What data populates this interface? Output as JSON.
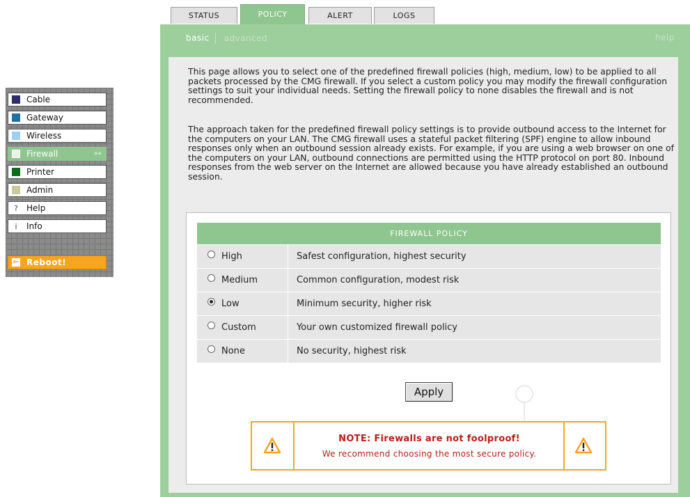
{
  "tabs": [
    {
      "label": "STATUS"
    },
    {
      "label": "POLICY",
      "active": true
    },
    {
      "label": "ALERT"
    },
    {
      "label": "LOGS"
    }
  ],
  "subnav": {
    "basic": "basic",
    "advanced": "advanced",
    "help": "help"
  },
  "nav": {
    "items": [
      {
        "label": "Cable",
        "color": "#2c2c6e"
      },
      {
        "label": "Gateway",
        "color": "#1f6fa8"
      },
      {
        "label": "Wireless",
        "color": "#9fcff2"
      },
      {
        "label": "Firewall",
        "arrows": "»»",
        "active": true
      },
      {
        "label": "Printer",
        "color": "#0e6b1a"
      },
      {
        "label": "Admin",
        "color": "#c9c99a"
      },
      {
        "label": "Help",
        "glyph": "?"
      },
      {
        "label": "Info",
        "glyph": "i"
      }
    ],
    "reboot": {
      "label": "Reboot!",
      "icon": "←"
    }
  },
  "intro": {
    "para1": "This page allows you to select one of the predefined firewall policies (high, medium, low) to be applied to all packets processed by the CMG firewall. If you select a custom policy you may modify the firewall configuration settings to suit your individual needs. Setting the firewall policy to none disables the firewall and is not recommended.",
    "para2": "The approach taken for the predefined firewall policy settings is to provide outbound access to the Internet for the computers on your LAN. The CMG firewall uses a stateful packet filtering (SPF) engine to allow inbound responses only when an outbound session already exists. For example, if you are using a web browser on one of the computers on your LAN, outbound connections are permitted using the HTTP protocol on port 80. Inbound responses from the web server on the Internet are allowed because you have already established an outbound session."
  },
  "policy": {
    "header": "FIREWALL POLICY",
    "selected": "Low",
    "options": [
      {
        "label": "High",
        "desc": "Safest configuration, highest security"
      },
      {
        "label": "Medium",
        "desc": "Common configuration, modest risk"
      },
      {
        "label": "Low",
        "desc": "Minimum security, higher risk"
      },
      {
        "label": "Custom",
        "desc": "Your own customized firewall policy"
      },
      {
        "label": "None",
        "desc": "No security, highest risk"
      }
    ],
    "apply_label": "Apply"
  },
  "note": {
    "title": "NOTE: Firewalls are not foolproof!",
    "text": "We recommend choosing the most secure policy."
  },
  "colors": {
    "accent_green": "#9ccf9c",
    "warning_orange": "#f7a51e",
    "note_red": "#b71c1c"
  }
}
